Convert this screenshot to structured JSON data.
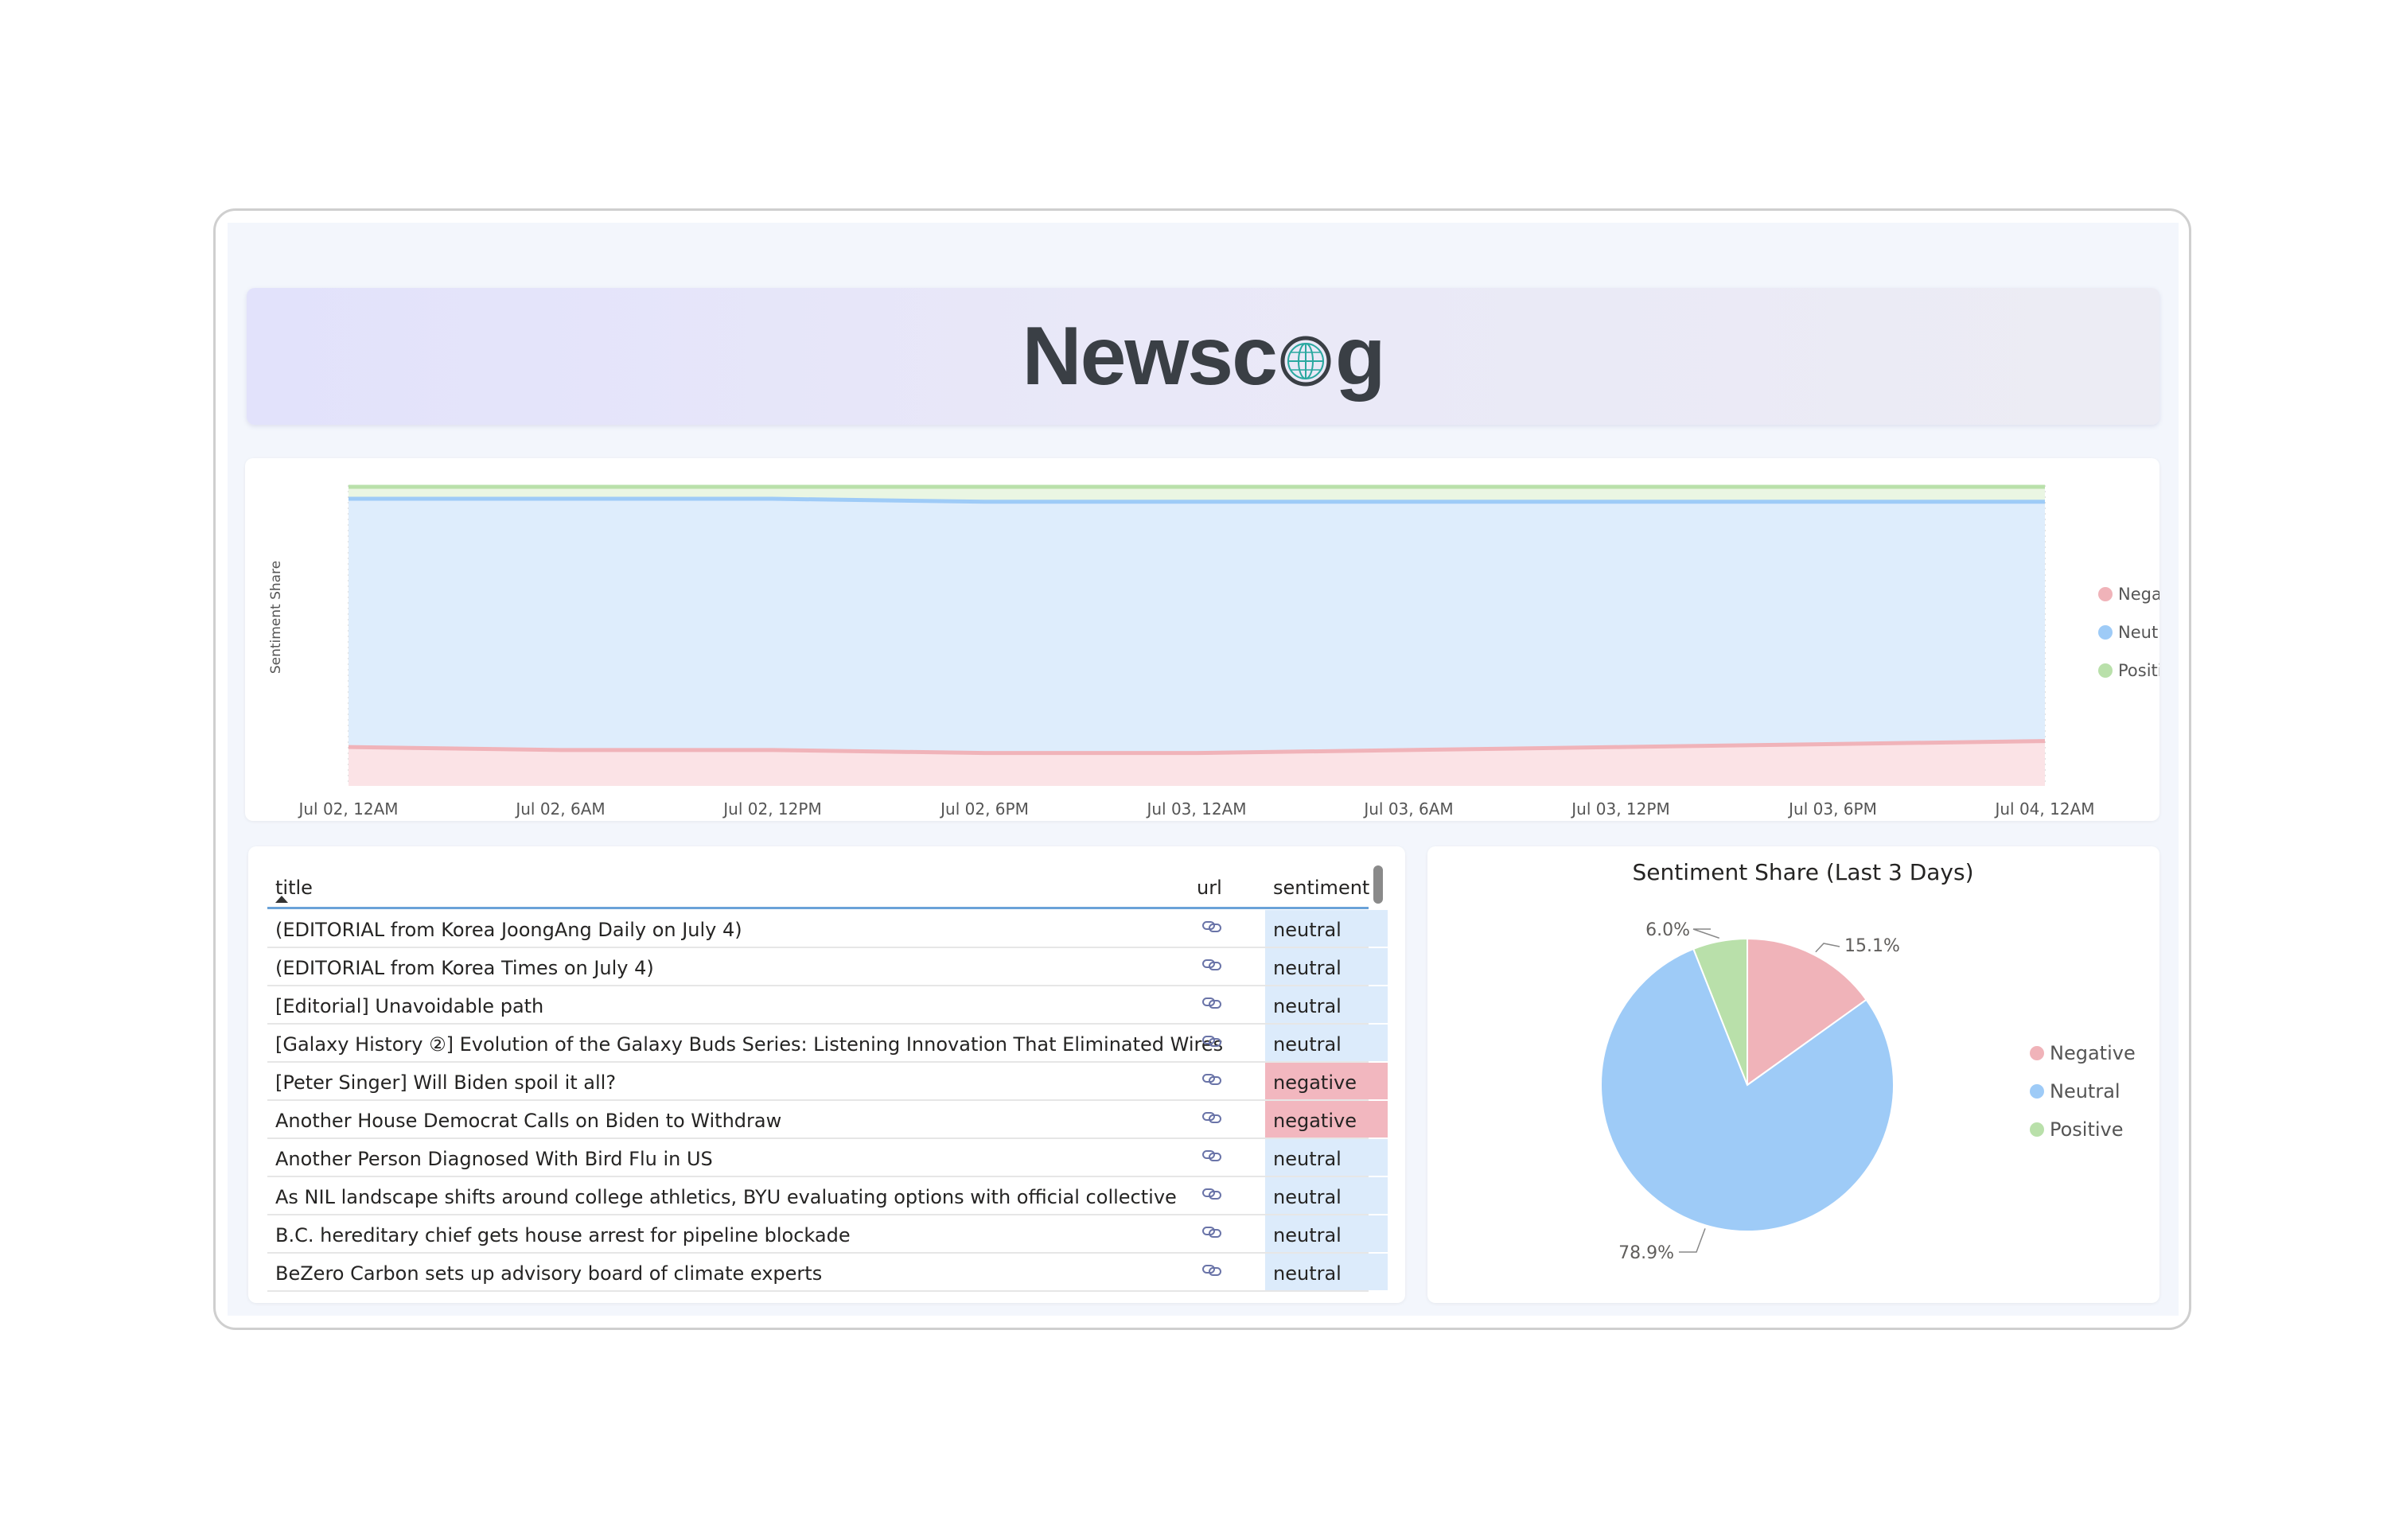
{
  "header": {
    "logo_text_left": "Newsc",
    "logo_text_right": "g",
    "logo_alt": "Newscog"
  },
  "area_chart": {
    "y_label": "Sentiment Share",
    "legend": [
      {
        "name": "Negative",
        "color": "#f0b3b9"
      },
      {
        "name": "Neutral",
        "color": "#9ecbf7"
      },
      {
        "name": "Positive",
        "color": "#b9e0aa"
      }
    ]
  },
  "table": {
    "columns": {
      "title": "title",
      "url": "url",
      "sentiment": "sentiment"
    },
    "rows": [
      {
        "title": "(EDITORIAL from Korea JoongAng Daily on July 4)",
        "sentiment": "neutral"
      },
      {
        "title": "(EDITORIAL from Korea Times on July 4)",
        "sentiment": "neutral"
      },
      {
        "title": "[Editorial] Unavoidable path",
        "sentiment": "neutral"
      },
      {
        "title": "[Galaxy History ②] Evolution of the Galaxy Buds Series: Listening Innovation That Eliminated Wires",
        "sentiment": "neutral"
      },
      {
        "title": "[Peter Singer] Will Biden spoil it all?",
        "sentiment": "negative"
      },
      {
        "title": "Another House Democrat Calls on Biden to Withdraw",
        "sentiment": "negative"
      },
      {
        "title": "Another Person Diagnosed With Bird Flu in US",
        "sentiment": "neutral"
      },
      {
        "title": "As NIL landscape shifts around college athletics, BYU evaluating options with official collective",
        "sentiment": "neutral"
      },
      {
        "title": "B.C. hereditary chief gets house arrest for pipeline blockade",
        "sentiment": "neutral"
      },
      {
        "title": "BeZero Carbon sets up advisory board of climate experts",
        "sentiment": "neutral"
      }
    ]
  },
  "chart_data": [
    {
      "type": "area",
      "stacked": true,
      "normalized": true,
      "x": [
        "Jul 02, 12AM",
        "Jul 02, 6AM",
        "Jul 02, 12PM",
        "Jul 02, 6PM",
        "Jul 03, 12AM",
        "Jul 03, 6AM",
        "Jul 03, 12PM",
        "Jul 03, 6PM",
        "Jul 04, 12AM"
      ],
      "series": [
        {
          "name": "Negative",
          "values": [
            0.13,
            0.12,
            0.12,
            0.11,
            0.11,
            0.12,
            0.13,
            0.14,
            0.15
          ]
        },
        {
          "name": "Neutral",
          "values": [
            0.83,
            0.84,
            0.84,
            0.84,
            0.84,
            0.83,
            0.82,
            0.81,
            0.8
          ]
        },
        {
          "name": "Positive",
          "values": [
            0.04,
            0.04,
            0.04,
            0.05,
            0.05,
            0.05,
            0.05,
            0.05,
            0.05
          ]
        }
      ],
      "ylabel": "Sentiment Share",
      "ylim": [
        0,
        1
      ],
      "legend": "right",
      "colors": {
        "Negative": "#f0b3b9",
        "Neutral": "#9ecbf7",
        "Positive": "#b9e0aa"
      }
    },
    {
      "type": "pie",
      "title": "Sentiment Share (Last 3 Days)",
      "categories": [
        "Negative",
        "Neutral",
        "Positive"
      ],
      "values": [
        15.1,
        78.9,
        6.0
      ],
      "labels": [
        "15.1%",
        "78.9%",
        "6.0%"
      ],
      "legend": "right",
      "colors": {
        "Negative": "#f0b3b9",
        "Neutral": "#9ecbf7",
        "Positive": "#b9e0aa"
      }
    }
  ]
}
